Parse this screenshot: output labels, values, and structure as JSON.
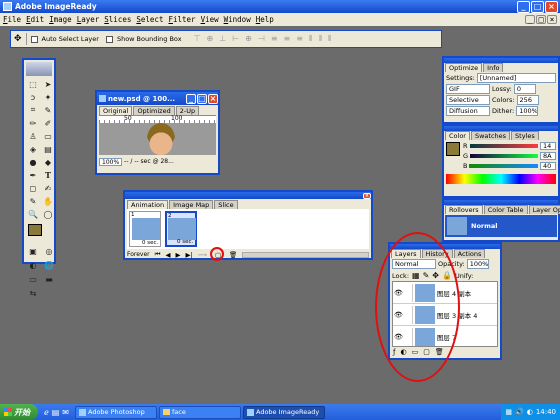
{
  "app": {
    "title": "Adobe ImageReady",
    "menu": [
      "File",
      "Edit",
      "Image",
      "Layer",
      "Slices",
      "Select",
      "Filter",
      "View",
      "Window",
      "Help"
    ],
    "menu_hotkeys": [
      "F",
      "E",
      "I",
      "L",
      "S",
      "S",
      "F",
      "V",
      "W",
      "H"
    ]
  },
  "options_bar": {
    "auto_select_label": "Auto Select Layer",
    "show_bounding_label": "Show Bounding Box"
  },
  "doc_window": {
    "title": "new.psd @ 100...",
    "tabs": [
      "Original",
      "Optimized",
      "2-Up"
    ],
    "ruler_marks": [
      "50",
      "100"
    ],
    "zoom": "100%",
    "status_left": "-- / -- sec @ 28..."
  },
  "animation": {
    "tabs": [
      "Animation",
      "Image Map",
      "Slice"
    ],
    "frames": [
      {
        "num": "1",
        "delay": "0 sec."
      },
      {
        "num": "2",
        "delay": "0 sec."
      }
    ],
    "loop": "Forever"
  },
  "optimize": {
    "tabs": [
      "Optimize",
      "Info"
    ],
    "settings_label": "Settings:",
    "settings_value": "[Unnamed]",
    "format": "GIF",
    "lossy_label": "Lossy:",
    "lossy_value": "0",
    "reduction": "Selective",
    "colors_label": "Colors:",
    "colors_value": "256",
    "dither_algo": "Diffusion",
    "dither_label": "Dither:",
    "dither_value": "100%"
  },
  "color": {
    "tabs": [
      "Color",
      "Swatches",
      "Styles"
    ],
    "r_label": "R",
    "g_label": "G",
    "b_label": "B",
    "r_value": "14",
    "g_value": "8A",
    "b_value": "40"
  },
  "rollovers": {
    "tabs": [
      "Rollovers",
      "Color Table",
      "Layer Options"
    ],
    "state": "Normal"
  },
  "layers": {
    "tabs": [
      "Layers",
      "History",
      "Actions"
    ],
    "blend": "Normal",
    "opacity_label": "Opacity:",
    "opacity_value": "100%",
    "lock_label": "Lock:",
    "unify_label": "Unify:",
    "items": [
      {
        "name": "图层 4 副本"
      },
      {
        "name": "图层 3 副本 4"
      },
      {
        "name": "图层 7"
      }
    ]
  },
  "taskbar": {
    "start": "开始",
    "tasks": [
      "Adobe Photoshop",
      "face",
      "Adobe ImageReady"
    ],
    "clock": "14:40"
  },
  "colors": {
    "titlebar": "#1449c9",
    "desktop": "#6b6b6b",
    "annotation": "#e01010",
    "taskbar": "#245edb",
    "start": "#3c9a3c"
  }
}
